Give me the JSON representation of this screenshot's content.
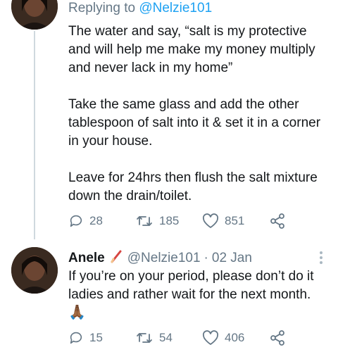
{
  "tweet1": {
    "avatar_icon": "user-avatar",
    "replying_prefix": "Replying to ",
    "replying_handle": "@Nelzie101",
    "text": "The water and say, “salt is my protective\nand will help me make my money multiply\nand never lack in my home”\n\nTake the same glass and add the other\ntablespoon of salt into it & set it in a corner\nin your house.\n\nLeave for 24hrs then flush the salt mixture\ndown the drain/toilet.",
    "reply_count": "28",
    "retweet_count": "185",
    "like_count": "851",
    "share_icon": "share-icon"
  },
  "tweet2": {
    "avatar_icon": "user-avatar",
    "name": "Anele",
    "name_emoji_icon": "pencil-icon",
    "handle": "@Nelzie101",
    "separator": "·",
    "date": "02 Jan",
    "text": "If you’re on your period, please don’t do it\nladies and rather wait for the next month.",
    "emoji": "🙏🏾",
    "reply_count": "15",
    "retweet_count": "54",
    "like_count": "406",
    "share_icon": "share-icon",
    "more_icon": "more-options-icon"
  },
  "colors": {
    "text": "#14171a",
    "secondary": "#657786",
    "link": "#1da1f2",
    "divider": "#cfd9de"
  }
}
